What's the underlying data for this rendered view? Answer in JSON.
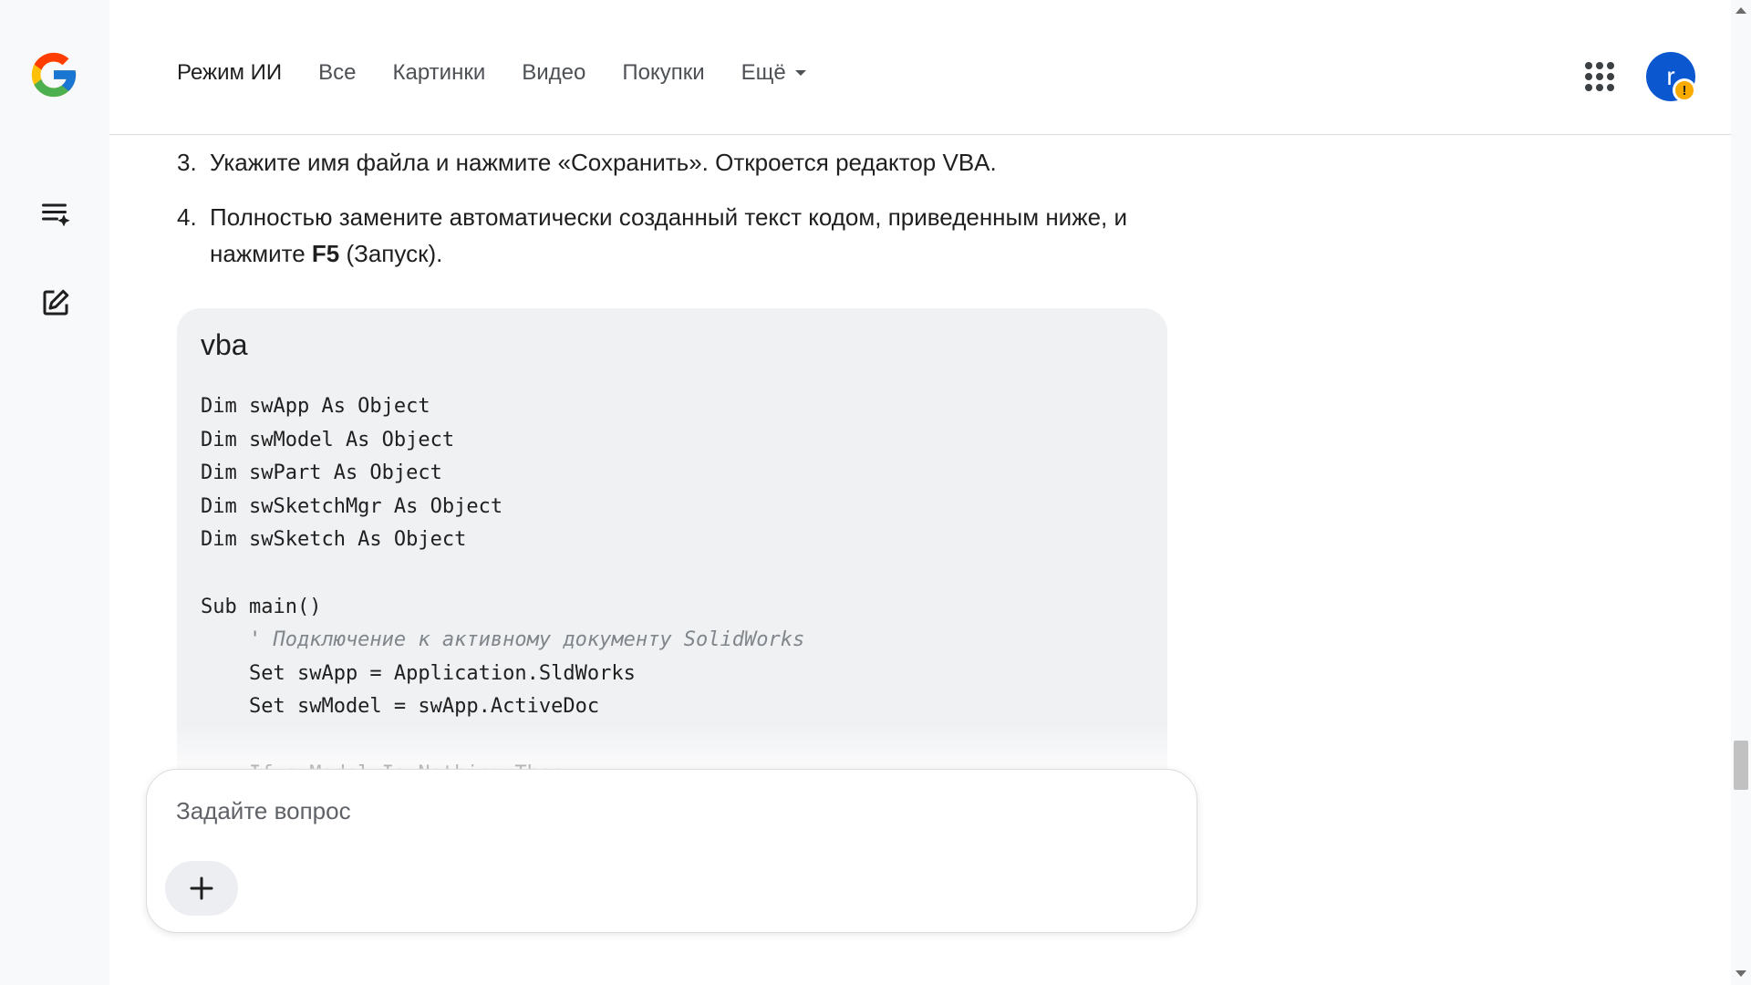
{
  "nav": {
    "items": [
      {
        "label": "Режим ИИ",
        "active": true
      },
      {
        "label": "Все"
      },
      {
        "label": "Картинки"
      },
      {
        "label": "Видео"
      },
      {
        "label": "Покупки"
      },
      {
        "label": "Ещё",
        "dropdown": true
      }
    ]
  },
  "account": {
    "initial": "r",
    "badge": "!"
  },
  "steps": {
    "s3": {
      "num": "3.",
      "text": "Укажите имя файла и нажмите «Сохранить». Откроется редактор VBA."
    },
    "s4": {
      "num": "4.",
      "text_before": "Полностью замените автоматически созданный текст кодом, приведенным ниже, и нажмите ",
      "key": "F5",
      "text_after": " (Запуск)."
    }
  },
  "code": {
    "language": "vba",
    "lines": [
      {
        "text": "Dim swApp As Object"
      },
      {
        "text": "Dim swModel As Object"
      },
      {
        "text": "Dim swPart As Object"
      },
      {
        "text": "Dim swSketchMgr As Object"
      },
      {
        "text": "Dim swSketch As Object"
      },
      {
        "text": ""
      },
      {
        "text": "Sub main()"
      },
      {
        "text": "    ' Подключение к активному документу SolidWorks",
        "comment": true
      },
      {
        "text": "    Set swApp = Application.SldWorks"
      },
      {
        "text": "    Set swModel = swApp.ActiveDoc"
      },
      {
        "text": ""
      },
      {
        "text": "    If swModel Is Nothing Then"
      }
    ]
  },
  "composer": {
    "placeholder": "Задайте вопрос",
    "value": ""
  },
  "colors": {
    "sidebar_bg": "#f8f9fa",
    "code_bg": "#f0f1f3",
    "avatar_bg": "#0b57d0",
    "badge_bg": "#f9ab00"
  },
  "icons": [
    "google-logo-icon",
    "history-icon",
    "new-chat-icon",
    "apps-grid-icon",
    "plus-icon",
    "warning-icon"
  ]
}
